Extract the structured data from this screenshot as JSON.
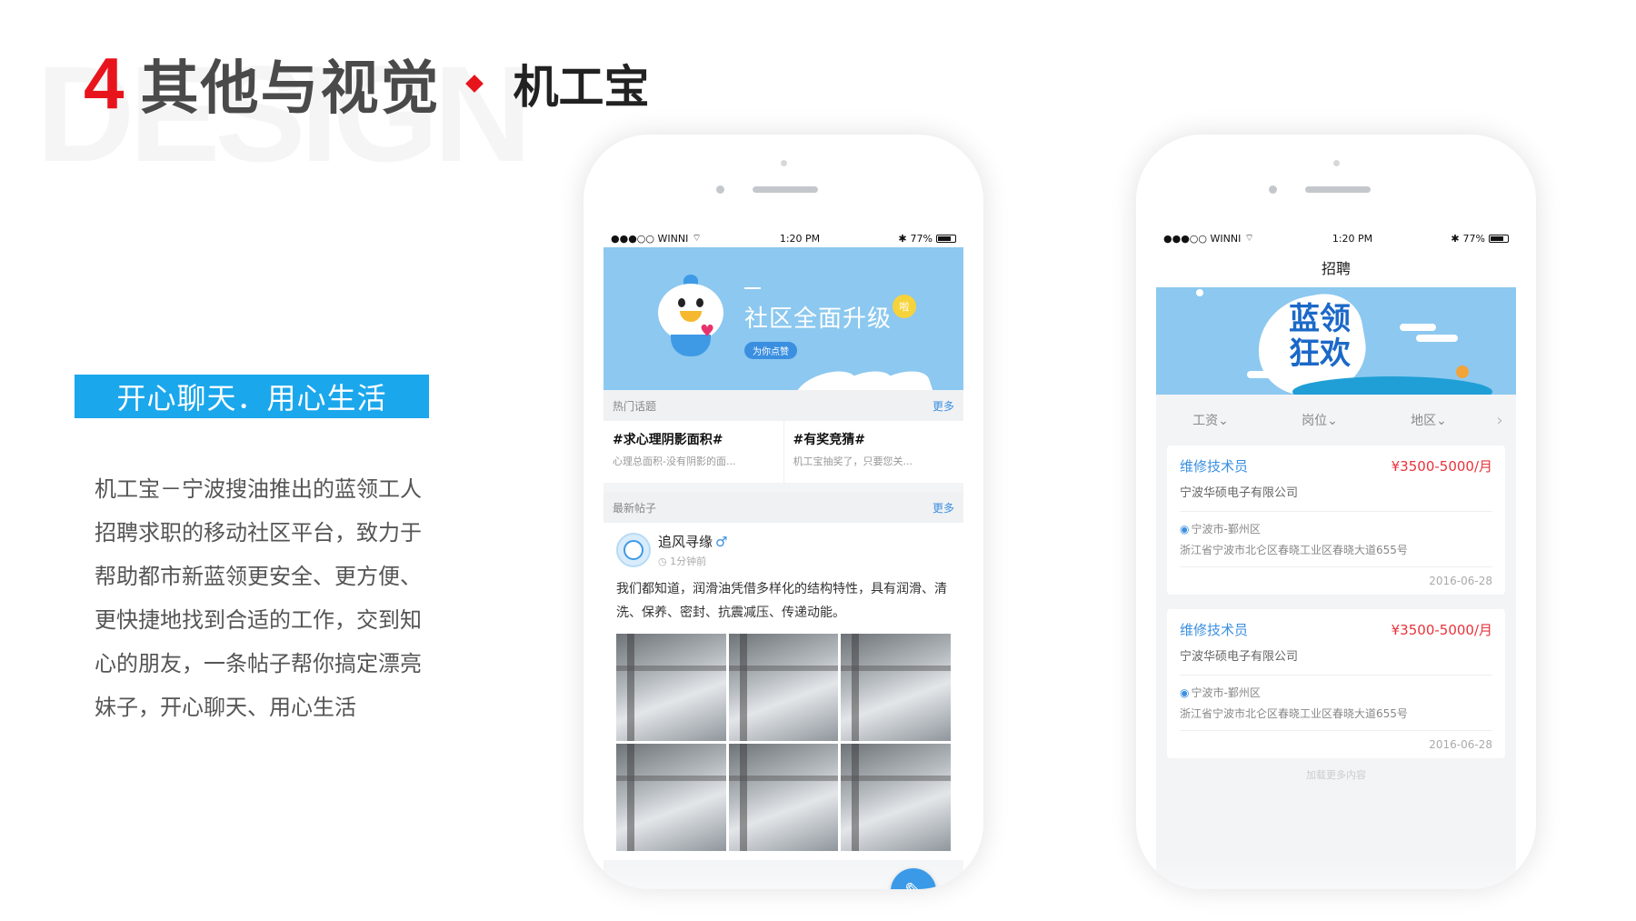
{
  "slide": {
    "bg_word": "DESIGN",
    "number": "4",
    "title": "其他与视觉",
    "subtitle": "机工宝",
    "slogan": "开心聊天．用心生活",
    "description": "机工宝－宁波搜油推出的蓝领工人招聘求职的移动社区平台，致力于帮助都市新蓝领更安全、更方便、更快捷地找到合适的工作，交到知心的朋友，一条帖子帮你搞定漂亮妹子，开心聊天、用心生活"
  },
  "status_bar": {
    "carrier": "●●●○○ WINNI",
    "time": "1:20 PM",
    "battery": "77%"
  },
  "phone1": {
    "banner": {
      "title": "社区全面升级",
      "badge": "啦",
      "pill": "为你点赞"
    },
    "hot_topics": {
      "label": "热门话题",
      "more": "更多",
      "items": [
        {
          "title": "#求心理阴影面积#",
          "snippet": "心理总面积-没有阴影的面..."
        },
        {
          "title": "#有奖竞猜#",
          "snippet": "机工宝抽奖了，只要您关..."
        }
      ]
    },
    "latest_posts": {
      "label": "最新帖子",
      "more": "更多"
    },
    "post": {
      "username": "追风寻缘",
      "gender": "♂",
      "time": "1分钟前",
      "text": "我们都知道，润滑油凭借多样化的结构特性，具有润滑、清洗、保养、密封、抗震减压、传递动能。"
    },
    "fab_icon": "edit-icon"
  },
  "phone2": {
    "nav_title": "招聘",
    "banner": {
      "line1": "蓝领",
      "line2": "狂欢"
    },
    "filters": [
      "工资⌄",
      "岗位⌄",
      "地区⌄"
    ],
    "jobs": [
      {
        "title": "维修技术员",
        "salary": "¥3500-5000/月",
        "company": "宁波华硕电子有限公司",
        "location": "宁波市-鄞州区",
        "address": "浙江省宁波市北仑区春晓工业区春晓大道655号",
        "date": "2016-06-28"
      },
      {
        "title": "维修技术员",
        "salary": "¥3500-5000/月",
        "company": "宁波华硕电子有限公司",
        "location": "宁波市-鄞州区",
        "address": "浙江省宁波市北仑区春晓工业区春晓大道655号",
        "date": "2016-06-28"
      }
    ],
    "load_more": "加载更多内容"
  },
  "colors": {
    "accent_red": "#e8141c",
    "accent_blue": "#1ba7ec",
    "salary_red": "#e8333a"
  }
}
